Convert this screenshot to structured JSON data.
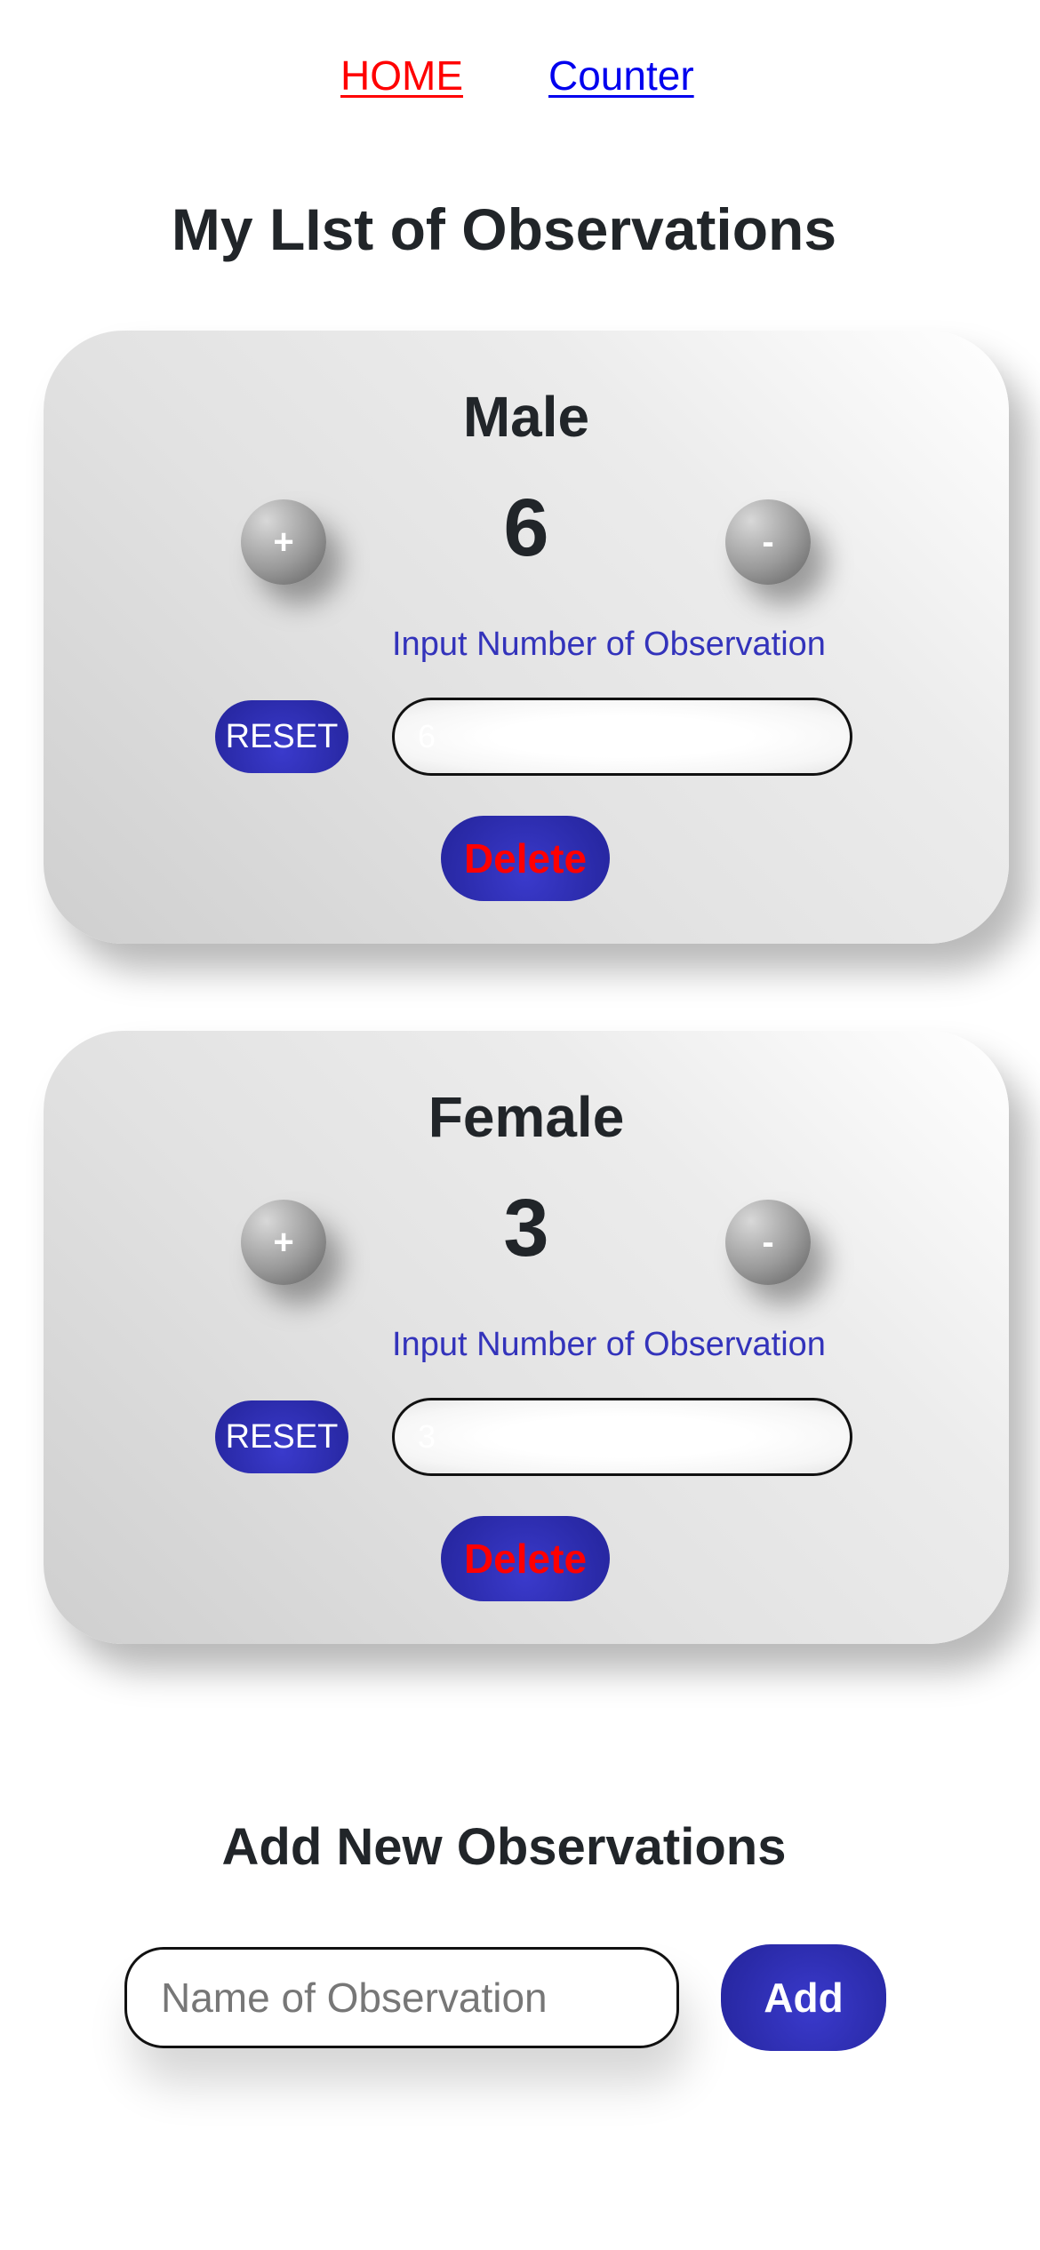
{
  "nav": {
    "home_label": "HOME",
    "counter_label": "Counter"
  },
  "page": {
    "title": "My LIst of Observations"
  },
  "observations": [
    {
      "name": "Male",
      "count": "6",
      "plus_label": "+",
      "minus_label": "-",
      "input_label": "Input Number of Observation",
      "reset_label": "RESET",
      "input_value": "6",
      "delete_label": "Delete"
    },
    {
      "name": "Female",
      "count": "3",
      "plus_label": "+",
      "minus_label": "-",
      "input_label": "Input Number of Observation",
      "reset_label": "RESET",
      "input_value": "3",
      "delete_label": "Delete"
    }
  ],
  "add_section": {
    "title": "Add New Observations",
    "input_placeholder": "Name of Observation",
    "input_value": "",
    "add_label": "Add"
  },
  "colors": {
    "home_link": "#ff0000",
    "counter_link": "#0000ee",
    "accent_blue": "#2a2aa8",
    "label_blue": "#3333bb",
    "delete_text": "#ff0000",
    "text_dark": "#212529"
  }
}
